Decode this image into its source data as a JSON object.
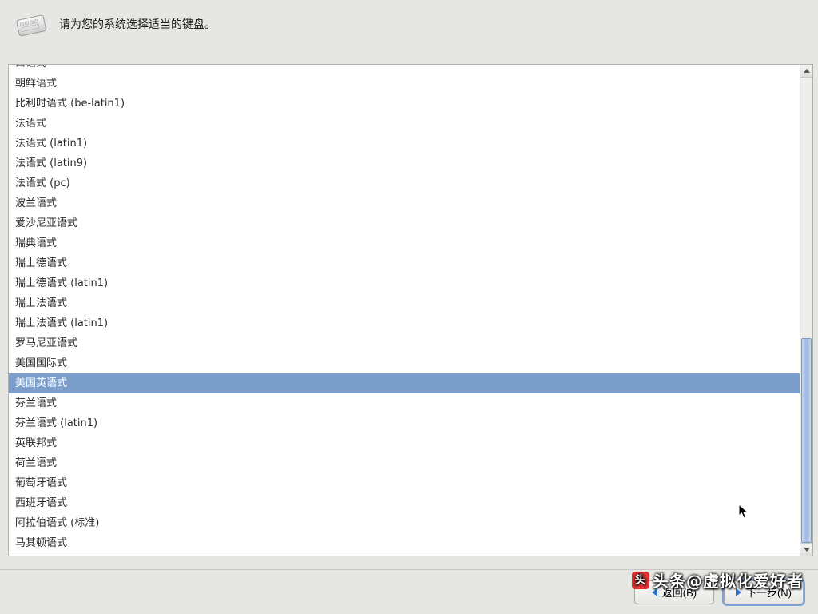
{
  "header": {
    "instruction": "请为您的系统选择适当的键盘。"
  },
  "keyboard_list": {
    "selected_index": 16,
    "items": [
      "口语式",
      "朝鲜语式",
      "比利时语式 (be-latin1)",
      "法语式",
      "法语式 (latin1)",
      "法语式 (latin9)",
      "法语式 (pc)",
      "波兰语式",
      "爱沙尼亚语式",
      "瑞典语式",
      "瑞士德语式",
      "瑞士德语式 (latin1)",
      "瑞士法语式",
      "瑞士法语式 (latin1)",
      "罗马尼亚语式",
      "美国国际式",
      "美国英语式",
      "芬兰语式",
      "芬兰语式 (latin1)",
      "英联邦式",
      "荷兰语式",
      "葡萄牙语式",
      "西班牙语式",
      "阿拉伯语式 (标准)",
      "马其顿语式"
    ]
  },
  "scrollbar": {
    "thumb_top_pct": 56,
    "thumb_height_pct": 44
  },
  "footer": {
    "back_label": "返回(B)",
    "next_label": "下一步(N)"
  },
  "watermark": {
    "text": "头条@虚拟化爱好者"
  }
}
